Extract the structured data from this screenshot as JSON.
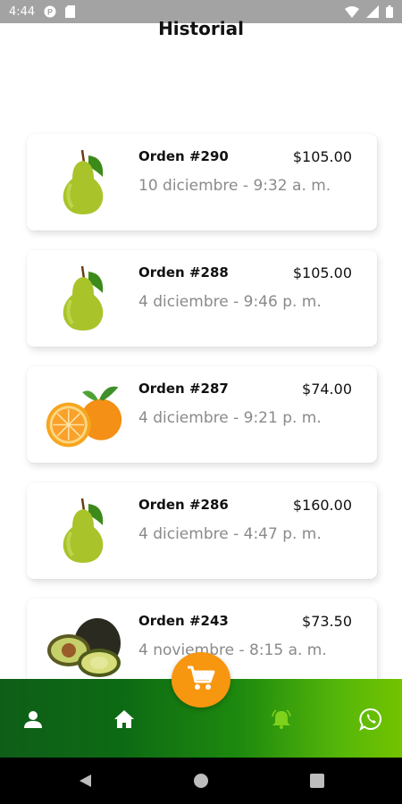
{
  "status_bar": {
    "time": "4:44"
  },
  "header": {
    "title": "Historial"
  },
  "orders": [
    {
      "title": "Orden #290",
      "total": "$105.00",
      "date": "10 diciembre - 9:32 a. m.",
      "image": "pear-icon"
    },
    {
      "title": "Orden #288",
      "total": "$105.00",
      "date": "4 diciembre - 9:46 p. m.",
      "image": "pear-icon"
    },
    {
      "title": "Orden #287",
      "total": "$74.00",
      "date": "4 diciembre - 9:21 p. m.",
      "image": "orange-icon"
    },
    {
      "title": "Orden #286",
      "total": "$160.00",
      "date": "4 diciembre - 4:47 p. m.",
      "image": "pear-icon"
    },
    {
      "title": "Orden #243",
      "total": "$73.50",
      "date": "4 noviembre - 8:15 a. m.",
      "image": "avocado-icon"
    }
  ],
  "bottom_nav": {
    "items": [
      "profile-icon",
      "home-icon",
      "bell-icon",
      "whatsapp-icon"
    ],
    "fab": "cart-icon",
    "colors": {
      "start": "#0f5e18",
      "end": "#73c300",
      "fab": "#f7960f",
      "bell": "#7fd11c"
    }
  },
  "system_nav": {
    "items": [
      "back-icon",
      "home-circle-icon",
      "recents-icon"
    ]
  }
}
